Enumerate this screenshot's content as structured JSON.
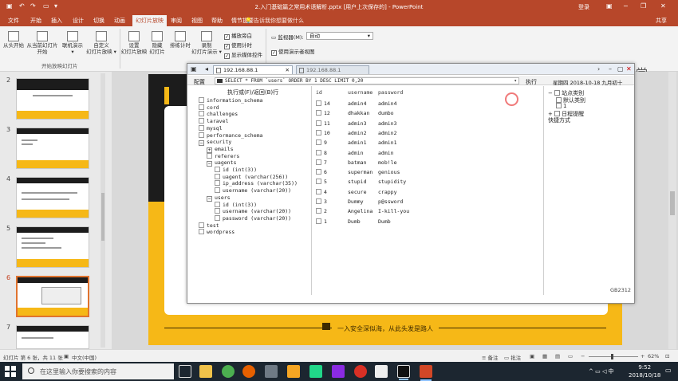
{
  "app": {
    "window_title": "2.入门基础篇之常用术语解析.pptx [用户上次保存的] - PowerPoint",
    "login": "登录",
    "share": "共享",
    "tell_me": "告诉我你想要做什么",
    "tabs": [
      "文件",
      "开始",
      "插入",
      "设计",
      "切换",
      "动画",
      "幻灯片放映",
      "审阅",
      "视图",
      "帮助",
      "情节提要"
    ],
    "active_tab": "幻灯片放映"
  },
  "ribbon": {
    "buttons": [
      {
        "label1": "从头开始",
        "label2": ""
      },
      {
        "label1": "从当前幻灯片",
        "label2": "开始"
      },
      {
        "label1": "联机演示",
        "label2": "▾"
      },
      {
        "label1": "自定义",
        "label2": "幻灯片放映 ▾"
      },
      {
        "label1": "设置",
        "label2": "幻灯片放映"
      },
      {
        "label1": "隐藏",
        "label2": "幻灯片"
      },
      {
        "label1": "排练计时",
        "label2": ""
      },
      {
        "label1": "录制",
        "label2": "幻灯片演示 ▾"
      }
    ],
    "group_start": "开始放映幻灯片",
    "checkboxes": [
      {
        "label": "播放旁白",
        "checked": true
      },
      {
        "label": "使用计时",
        "checked": true
      },
      {
        "label": "显示媒体控件",
        "checked": true
      }
    ],
    "monitor_label": "监视器(M):",
    "monitor_value": "自动",
    "presenter_view": "使用演示者视图",
    "brand": "网易云课堂"
  },
  "slides": {
    "numbers": [
      "2",
      "3",
      "4",
      "5",
      "6",
      "7"
    ],
    "selected": "6"
  },
  "slide": {
    "motto": "一入安全深似海，从此头发是路人"
  },
  "db": {
    "tab1": "192.168.88.1",
    "tab2": "192.168.88.1",
    "config": "配置",
    "sql": "SELECT * FROM `users` ORDER BY 1 DESC LIMIT 0,20",
    "execute": "执行",
    "date": "星期四  2018-10-18  九月初十",
    "exec_current": "执行或(F)/返回(B)行",
    "tree": [
      {
        "text": "information_schema",
        "indent": 0,
        "toggle": ""
      },
      {
        "text": "cord",
        "indent": 0,
        "toggle": ""
      },
      {
        "text": "challenges",
        "indent": 0,
        "toggle": ""
      },
      {
        "text": "laravel",
        "indent": 0,
        "toggle": ""
      },
      {
        "text": "mysql",
        "indent": 0,
        "toggle": ""
      },
      {
        "text": "performance_schema",
        "indent": 0,
        "toggle": ""
      },
      {
        "text": "security",
        "indent": 0,
        "toggle": "−"
      },
      {
        "text": "emails",
        "indent": 1,
        "toggle": "+"
      },
      {
        "text": "referers",
        "indent": 1,
        "toggle": ""
      },
      {
        "text": "uagents",
        "indent": 1,
        "toggle": "−"
      },
      {
        "text": "id (int(3))",
        "indent": 2,
        "toggle": ""
      },
      {
        "text": "uagent (varchar(256))",
        "indent": 2,
        "toggle": ""
      },
      {
        "text": "ip_address (varchar(35))",
        "indent": 2,
        "toggle": ""
      },
      {
        "text": "username (varchar(20))",
        "indent": 2,
        "toggle": ""
      },
      {
        "text": "users",
        "indent": 1,
        "toggle": "−"
      },
      {
        "text": "id (int(3))",
        "indent": 2,
        "toggle": ""
      },
      {
        "text": "username (varchar(20))",
        "indent": 2,
        "toggle": ""
      },
      {
        "text": "password (varchar(20))",
        "indent": 2,
        "toggle": ""
      },
      {
        "text": "test",
        "indent": 0,
        "toggle": ""
      },
      {
        "text": "wordpress",
        "indent": 0,
        "toggle": ""
      }
    ],
    "columns": [
      "id",
      "username",
      "password"
    ],
    "rows": [
      [
        "14",
        "admin4",
        "admin4"
      ],
      [
        "12",
        "dhakkan",
        "dumbo"
      ],
      [
        "11",
        "admin3",
        "admin3"
      ],
      [
        "10",
        "admin2",
        "admin2"
      ],
      [
        "9",
        "admin1",
        "admin1"
      ],
      [
        "8",
        "admin",
        "admin"
      ],
      [
        "7",
        "batman",
        "mob!le"
      ],
      [
        "6",
        "superman",
        "genious"
      ],
      [
        "5",
        "stupid",
        "stupidity"
      ],
      [
        "4",
        "secure",
        "crappy"
      ],
      [
        "3",
        "Dummy",
        "p@ssword"
      ],
      [
        "2",
        "Angelina",
        "I-kill-you"
      ],
      [
        "1",
        "Dumb",
        "Dumb"
      ]
    ],
    "right_tree": [
      {
        "text": "站点类别",
        "indent": 0,
        "box": true,
        "sign": "−"
      },
      {
        "text": "默认类别",
        "indent": 1,
        "box": true,
        "sign": ""
      },
      {
        "text": "1",
        "indent": 1,
        "box": true,
        "sign": ""
      },
      {
        "text": "日程提醒",
        "indent": 0,
        "box": true,
        "sign": "+"
      },
      {
        "text": "快捷方式",
        "indent": 0,
        "box": false,
        "sign": ""
      }
    ],
    "encoding": "GB2312"
  },
  "status": {
    "slide_info": "幻灯片 第 6 张，共 11 张",
    "lang": "中文(中国)",
    "notes": "备注",
    "comments": "批注",
    "zoom": "62%"
  },
  "taskbar": {
    "search_placeholder": "在这里输入你要搜索的内容",
    "time": "9:52",
    "date": "2018/10/18",
    "ime": "中"
  }
}
